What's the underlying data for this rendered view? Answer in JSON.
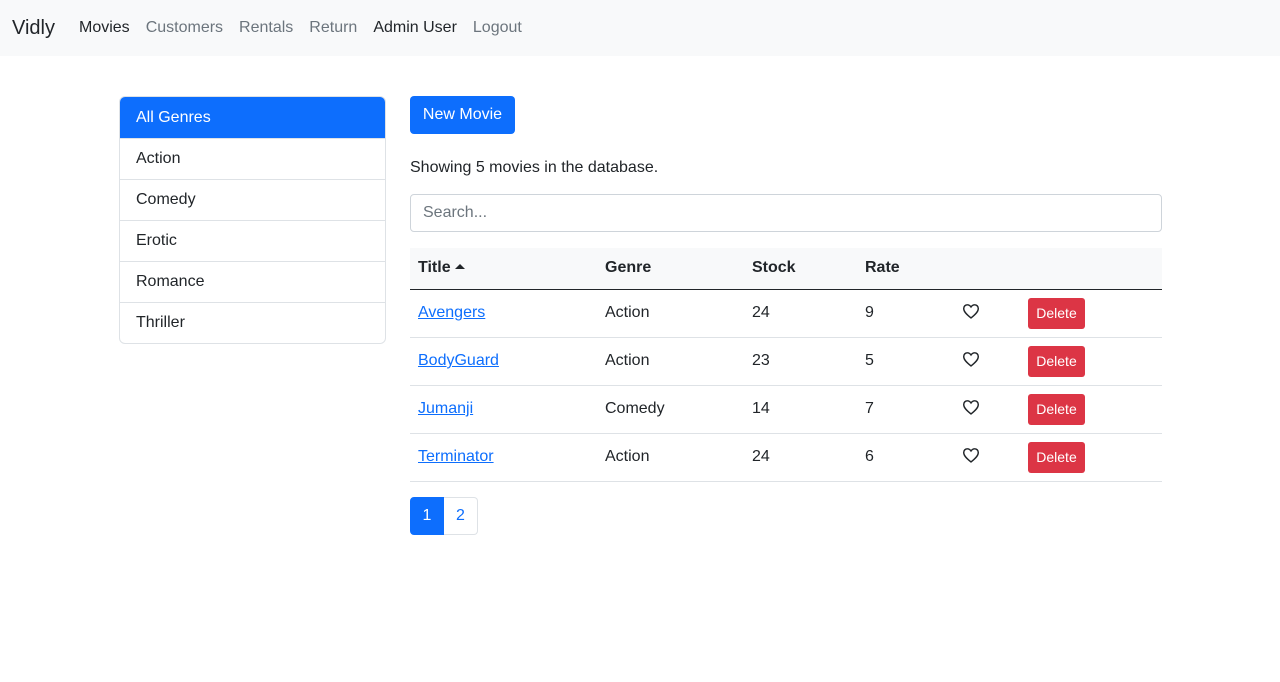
{
  "navbar": {
    "brand": "Vidly",
    "links": [
      {
        "label": "Movies",
        "active": true
      },
      {
        "label": "Customers",
        "active": false
      },
      {
        "label": "Rentals",
        "active": false
      },
      {
        "label": "Return",
        "active": false
      },
      {
        "label": "Admin User",
        "active": true
      },
      {
        "label": "Logout",
        "active": false
      }
    ]
  },
  "genres": {
    "items": [
      "All Genres",
      "Action",
      "Comedy",
      "Erotic",
      "Romance",
      "Thriller"
    ],
    "selected": "All Genres"
  },
  "main": {
    "new_movie_label": "New Movie",
    "count_text": "Showing 5 movies in the database.",
    "search_placeholder": "Search..."
  },
  "table": {
    "headers": {
      "title": "Title",
      "genre": "Genre",
      "stock": "Stock",
      "rate": "Rate"
    },
    "sort": {
      "column": "title",
      "order": "asc"
    },
    "delete_label": "Delete",
    "rows": [
      {
        "title": "Avengers",
        "genre": "Action",
        "stock": "24",
        "rate": "9"
      },
      {
        "title": "BodyGuard",
        "genre": "Action",
        "stock": "23",
        "rate": "5"
      },
      {
        "title": "Jumanji",
        "genre": "Comedy",
        "stock": "14",
        "rate": "7"
      },
      {
        "title": "Terminator",
        "genre": "Action",
        "stock": "24",
        "rate": "6"
      }
    ]
  },
  "pagination": {
    "pages": [
      "1",
      "2"
    ],
    "current": "1"
  },
  "colors": {
    "primary": "#0d6efd",
    "danger": "#dc3545",
    "navbar_bg": "#f8f9fa"
  }
}
